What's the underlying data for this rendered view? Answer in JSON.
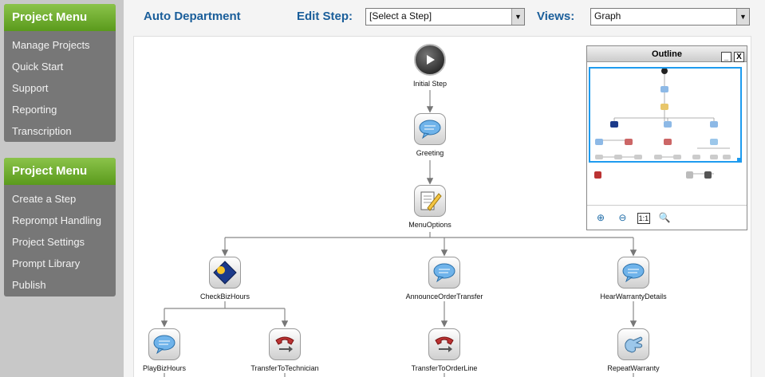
{
  "sidebar": {
    "panels": [
      {
        "title": "Project Menu",
        "items": [
          "Manage Projects",
          "Quick Start",
          "Support",
          "Reporting",
          "Transcription"
        ]
      },
      {
        "title": "Project Menu",
        "items": [
          "Create a Step",
          "Reprompt Handling",
          "Project Settings",
          "Prompt Library",
          "Publish"
        ]
      }
    ]
  },
  "header": {
    "department": "Auto Department",
    "edit_step_label": "Edit Step:",
    "edit_step_value": "[Select a Step]",
    "views_label": "Views:",
    "views_value": "Graph"
  },
  "graph": {
    "nodes": [
      {
        "id": "initial",
        "label": "Initial Step",
        "icon": "play-icon"
      },
      {
        "id": "greeting",
        "label": "Greeting",
        "icon": "speech-bubble-icon"
      },
      {
        "id": "menu",
        "label": "MenuOptions",
        "icon": "menu-edit-icon"
      },
      {
        "id": "bizhours",
        "label": "CheckBizHours",
        "icon": "day-night-icon"
      },
      {
        "id": "announce",
        "label": "AnnounceOrderTransfer",
        "icon": "speech-bubble-icon"
      },
      {
        "id": "warranty",
        "label": "HearWarrantyDetails",
        "icon": "speech-bubble-icon"
      },
      {
        "id": "playbiz",
        "label": "PlayBizHours",
        "icon": "speech-bubble-icon"
      },
      {
        "id": "techtransfer",
        "label": "TransferToTechnician",
        "icon": "phone-transfer-icon"
      },
      {
        "id": "ordertransfer",
        "label": "TransferToOrderLine",
        "icon": "phone-transfer-icon"
      },
      {
        "id": "repeat",
        "label": "RepeatWarranty",
        "icon": "hand-point-icon"
      }
    ]
  },
  "outline": {
    "title": "Outline",
    "minimize": "_",
    "close": "X",
    "actual_size": "1:1"
  },
  "colors": {
    "sidebar_bg": "#777777",
    "header_green": "#6aac2c",
    "label_blue": "#1a5e9a",
    "viewport_blue": "#1e9bef"
  }
}
